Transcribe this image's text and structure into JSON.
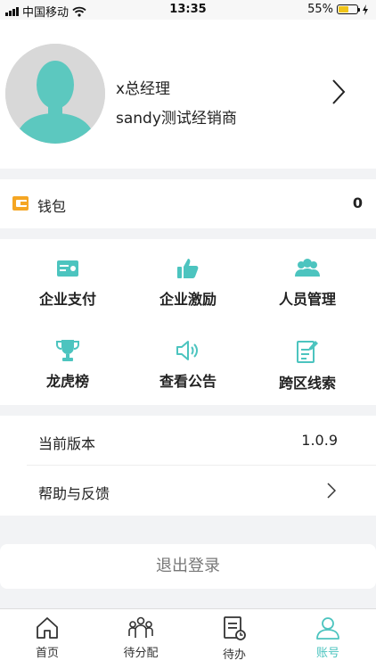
{
  "status_bar": {
    "carrier": "中国移动",
    "time": "13:35",
    "battery_percent": "55%",
    "battery_level": 0.55
  },
  "profile": {
    "title": "x总经理",
    "company": "sandy测试经销商"
  },
  "wallet": {
    "label": "钱包",
    "value": "0",
    "icon": "wallet-icon"
  },
  "grid": [
    {
      "label": "企业支付",
      "icon": "card-icon"
    },
    {
      "label": "企业激励",
      "icon": "thumbs-up-icon"
    },
    {
      "label": "人员管理",
      "icon": "people-icon"
    },
    {
      "label": "龙虎榜",
      "icon": "trophy-icon"
    },
    {
      "label": "查看公告",
      "icon": "speaker-icon"
    },
    {
      "label": "跨区线索",
      "icon": "edit-document-icon"
    }
  ],
  "list": {
    "version_label": "当前版本",
    "version_value": "1.0.9",
    "help_label": "帮助与反馈"
  },
  "logout_label": "退出登录",
  "tabs": [
    {
      "label": "首页",
      "icon": "home-icon"
    },
    {
      "label": "待分配",
      "icon": "team-icon"
    },
    {
      "label": "待办",
      "icon": "todo-icon"
    },
    {
      "label": "账号",
      "icon": "account-icon",
      "active": true
    }
  ],
  "colors": {
    "accent": "#4cc4bf",
    "wallet_orange": "#f5a623",
    "background": "#f2f3f5"
  }
}
